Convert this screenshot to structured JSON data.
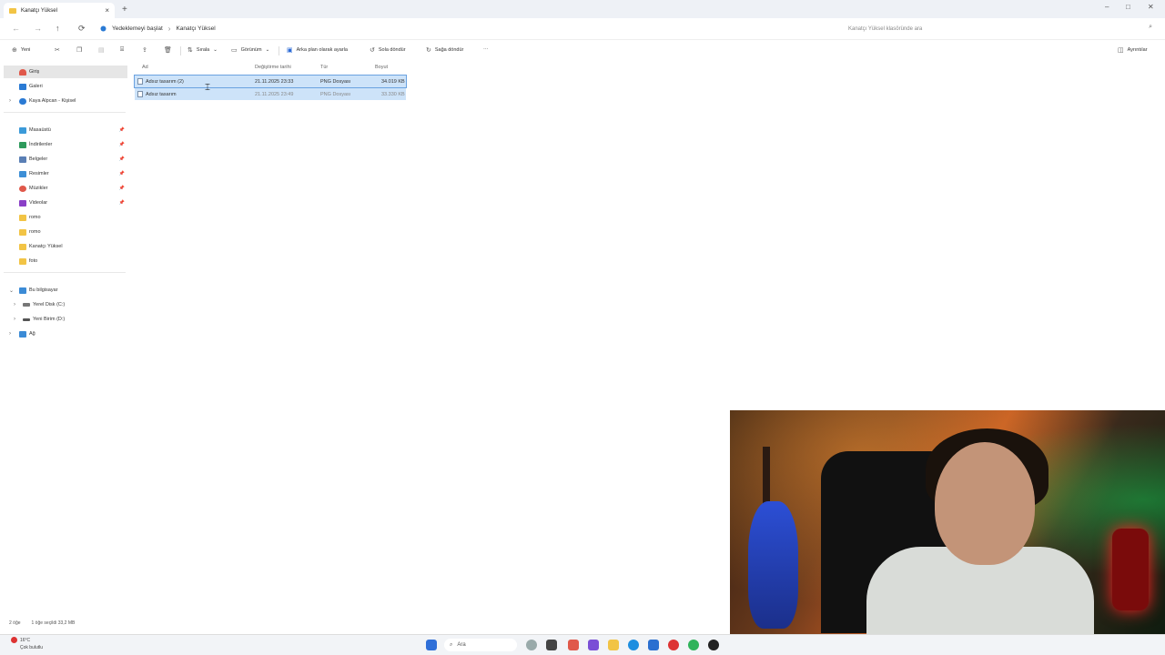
{
  "window": {
    "tab_title": "Kanatçı Yüksel",
    "new_tab": "+",
    "controls": [
      "–",
      "□",
      "✕"
    ]
  },
  "address": {
    "back": "←",
    "forward": "→",
    "up": "↑",
    "refresh": "⟳",
    "backup_label": "Yedeklemeyi başlat",
    "current_folder": "Kanatçı Yüksel",
    "search_placeholder": "Kanatçı Yüksel klasöründe ara"
  },
  "toolbar": {
    "new": "Yeni",
    "sort": "Sırala",
    "view": "Görünüm",
    "set_background": "Arka plan olarak ayarla",
    "rotate_left": "Sola döndür",
    "rotate_right": "Sağa döndür",
    "more": "···",
    "details": "Ayrıntılar"
  },
  "sidebar": {
    "items": [
      {
        "label": "Giriş",
        "icon": "home-icon",
        "color": "#e0584a"
      },
      {
        "label": "Galeri",
        "icon": "gallery-icon",
        "color": "#2a7ad4"
      },
      {
        "label": "Kaya Alpcan - Kişisel",
        "icon": "cloud-icon",
        "color": "#2a7ad4"
      },
      {
        "label": "Masaüstü",
        "icon": "desktop-icon",
        "color": "#3b9ad9"
      },
      {
        "label": "İndirilenler",
        "icon": "download-icon",
        "color": "#2e9a5c"
      },
      {
        "label": "Belgeler",
        "icon": "documents-icon",
        "color": "#5a7fb5"
      },
      {
        "label": "Resimler",
        "icon": "pictures-icon",
        "color": "#3d8fd6"
      },
      {
        "label": "Müzikler",
        "icon": "music-icon",
        "color": "#e0584a"
      },
      {
        "label": "Videolar",
        "icon": "videos-icon",
        "color": "#8a3fc7"
      },
      {
        "label": "romo",
        "icon": "folder-icon",
        "color": "#f2c445"
      },
      {
        "label": "romo",
        "icon": "folder-icon",
        "color": "#f2c445"
      },
      {
        "label": "Kanatçı Yüksel",
        "icon": "folder-icon",
        "color": "#f2c445"
      },
      {
        "label": "foto",
        "icon": "folder-icon",
        "color": "#f2c445"
      },
      {
        "label": "Bu bilgisayar",
        "icon": "computer-icon",
        "color": "#3b8bd6"
      },
      {
        "label": "Yerel Disk (C:)",
        "icon": "disk-icon",
        "color": "#777777"
      },
      {
        "label": "Yeni Birim (D:)",
        "icon": "disk-icon",
        "color": "#555555"
      },
      {
        "label": "Ağ",
        "icon": "network-icon",
        "color": "#3b8bd6"
      }
    ]
  },
  "files": {
    "headers": {
      "name": "Ad",
      "modified": "Değiştirme tarihi",
      "type": "Tür",
      "size": "Boyut"
    },
    "rows": [
      {
        "name": "Adsız tasarım (2)",
        "modified": "21.11.2025 23:33",
        "type": "PNG Dosyası",
        "size": "34.019 KB"
      },
      {
        "name": "Adsız tasarım",
        "modified": "21.11.2025 23:49",
        "type": "PNG Dosyası",
        "size": "33.330 KB"
      }
    ]
  },
  "status": {
    "count": "2 öğe",
    "selection": "1 öğe seçildi  33,2 MB"
  },
  "taskbar": {
    "temperature": "16°C",
    "weather": "Çok bulutlu",
    "search": "Ara",
    "apps": [
      "#2f6fd8",
      "#444444",
      "#e0594a",
      "#7a4fd6",
      "#f2c445",
      "#1d8ee0",
      "#2a6fd0",
      "#d33333",
      "#2fb35a",
      "#222222"
    ]
  }
}
